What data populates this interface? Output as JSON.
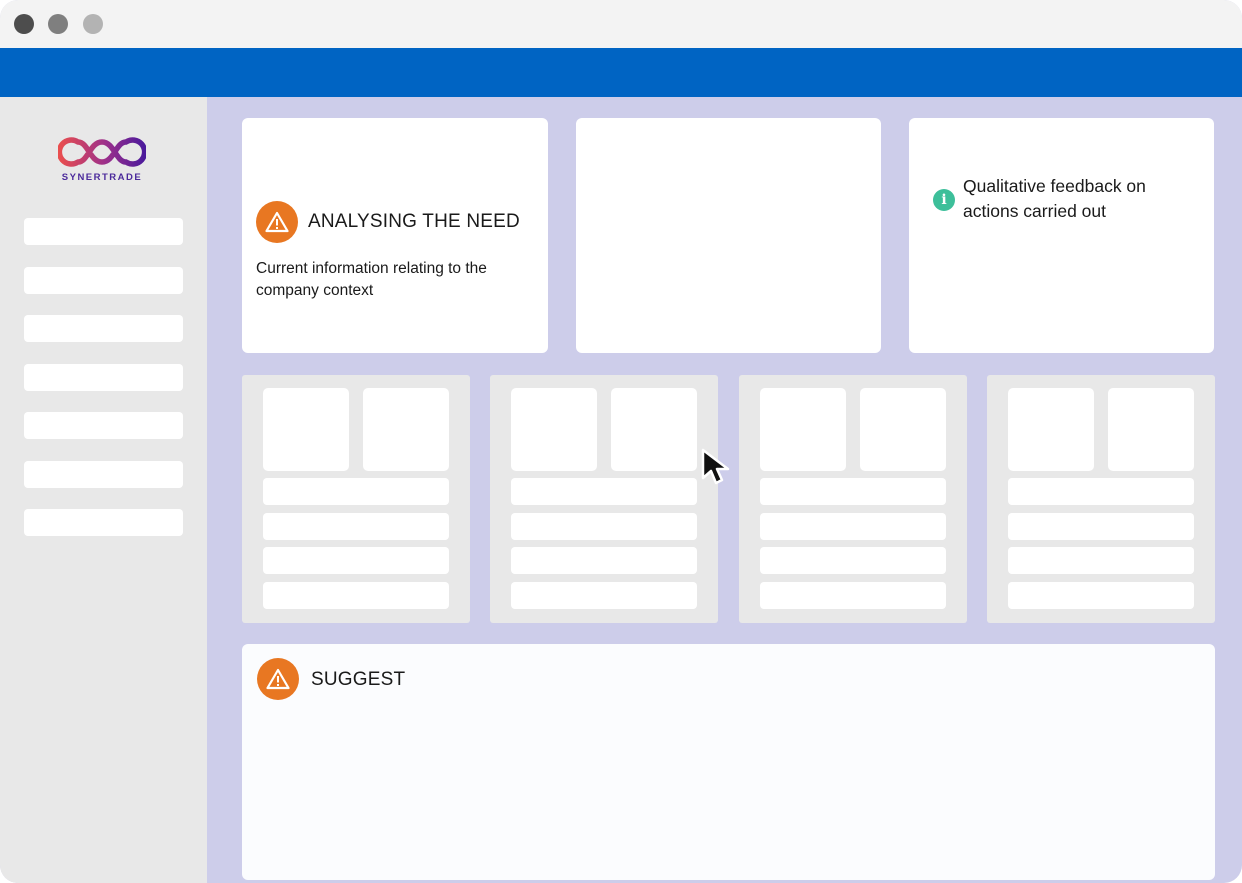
{
  "window": {
    "controls": [
      {
        "name": "close",
        "color": "#4d4d4d"
      },
      {
        "name": "minimize",
        "color": "#7f7f7f"
      },
      {
        "name": "maximize",
        "color": "#b3b3b3"
      }
    ],
    "topbar_color": "#0064c3",
    "canvas_color": "#cdcdea"
  },
  "sidebar": {
    "logo": {
      "text": "SYNERTRADE",
      "icon": "infinity-loops-logo-icon",
      "gradient": [
        "#e94e4e",
        "#9b2f8c",
        "#4b1a9b"
      ],
      "text_color": "#4b2a9b"
    },
    "items": [
      "",
      "",
      "",
      "",
      "",
      "",
      ""
    ]
  },
  "cards": {
    "need": {
      "icon": "warning-icon",
      "icon_color": "#e87722",
      "title": "ANALYSING THE NEED",
      "body": "Current information relating to the company context"
    },
    "middle": {},
    "feedback": {
      "icon": "info-icon",
      "icon_color": "#3dbf9a",
      "body": "Qualitative feedback on actions carried out"
    }
  },
  "tiles": [
    {
      "rows": 4
    },
    {
      "rows": 4
    },
    {
      "rows": 4
    },
    {
      "rows": 4
    }
  ],
  "suggest": {
    "icon": "warning-icon",
    "icon_color": "#e87722",
    "title": "SUGGEST"
  },
  "cursor": {
    "icon": "mouse-pointer-icon"
  }
}
